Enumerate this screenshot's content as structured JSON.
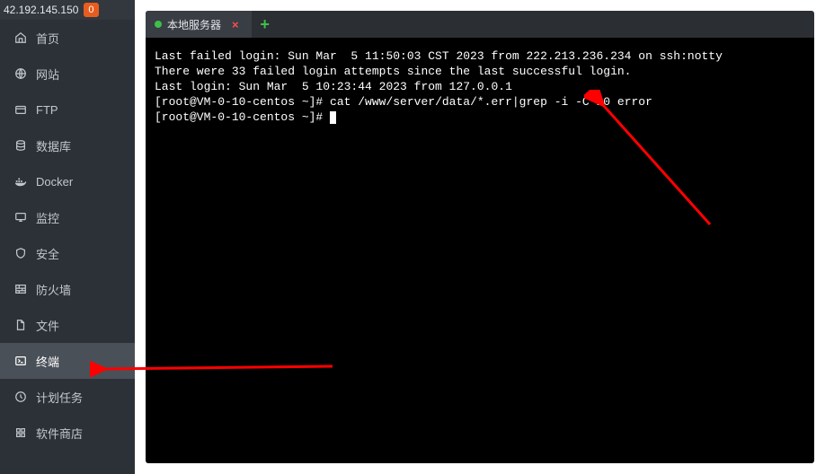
{
  "header": {
    "ip": "42.192.145.150",
    "badge": "0"
  },
  "sidebar": {
    "items": [
      {
        "key": "home",
        "label": "首页",
        "icon": "home-icon"
      },
      {
        "key": "site",
        "label": "网站",
        "icon": "globe-icon"
      },
      {
        "key": "ftp",
        "label": "FTP",
        "icon": "ftp-icon"
      },
      {
        "key": "database",
        "label": "数据库",
        "icon": "database-icon"
      },
      {
        "key": "docker",
        "label": "Docker",
        "icon": "docker-icon"
      },
      {
        "key": "monitor",
        "label": "监控",
        "icon": "monitor-icon"
      },
      {
        "key": "security",
        "label": "安全",
        "icon": "shield-icon"
      },
      {
        "key": "firewall",
        "label": "防火墙",
        "icon": "firewall-icon"
      },
      {
        "key": "files",
        "label": "文件",
        "icon": "files-icon"
      },
      {
        "key": "terminal",
        "label": "终端",
        "icon": "terminal-icon",
        "active": true
      },
      {
        "key": "cron",
        "label": "计划任务",
        "icon": "cron-icon"
      },
      {
        "key": "store",
        "label": "软件商店",
        "icon": "store-icon"
      }
    ]
  },
  "tabs": {
    "items": [
      {
        "label": "本地服务器",
        "status": "up"
      }
    ],
    "add_label": "+"
  },
  "terminal": {
    "lines": [
      "Last failed login: Sun Mar  5 11:50:03 CST 2023 from 222.213.236.234 on ssh:notty",
      "There were 33 failed login attempts since the last successful login.",
      "Last login: Sun Mar  5 10:23:44 2023 from 127.0.0.1"
    ],
    "prompt1": "[root@VM-0-10-centos ~]# ",
    "cmd1": "cat /www/server/data/*.err|grep -i -C 10 error",
    "prompt2": "[root@VM-0-10-centos ~]# "
  }
}
